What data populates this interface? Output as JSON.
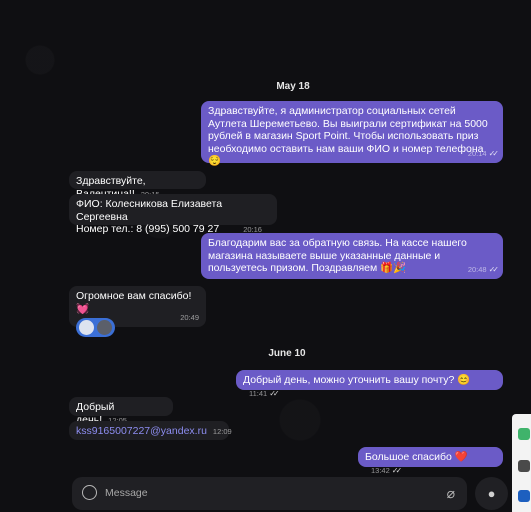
{
  "dates": [
    "May 18",
    "June 10"
  ],
  "messages": [
    {
      "dir": "out",
      "text": "Здравствуйте, я администратор социальных сетей Аутлета Шереметьево. Вы выиграли сертификат на 5000 рублей в магазин Sport Point. Чтобы использовать приз необходимо оставить нам ваши ФИО и номер телефона 😌",
      "time": "20:14",
      "read": "✓✓"
    },
    {
      "dir": "in",
      "text": "Здравствуйте, Валентина!!",
      "time": "20:15"
    },
    {
      "dir": "in",
      "text_line1": "ФИО: Колесникова Елизавета Сергеевна",
      "text_line2": "Номер тел.: 8 (995) 500 79 27",
      "time": "20:16"
    },
    {
      "dir": "out",
      "text": "Благодарим вас за обратную связь. На кассе нашего магазина называете выше указанные данные и пользуетесь призом. Поздравляем 🎁🎉",
      "time": "20:48",
      "read": "✓✓"
    },
    {
      "dir": "in",
      "text": "Огромное вам спасибо!💓",
      "time": "20:49"
    },
    {
      "dir": "out",
      "text": "Добрый день, можно уточнить вашу почту? 😊",
      "time": "11:41",
      "read": "✓✓"
    },
    {
      "dir": "in",
      "text": "Добрый день!",
      "time": "12:05"
    },
    {
      "dir": "in",
      "text": "kss9165007227@yandex.ru",
      "time": "12:09"
    },
    {
      "dir": "out",
      "text": "Большое спасибо ❤️",
      "time": "13:42",
      "read": "✓✓"
    }
  ],
  "composer": {
    "placeholder": "Message"
  },
  "icons": {
    "emoji": "smile-icon",
    "attach": "paperclip-icon",
    "mic": "microphone-icon"
  }
}
